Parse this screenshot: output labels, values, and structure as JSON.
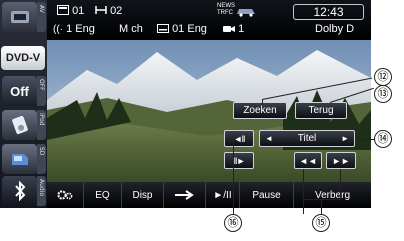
{
  "sidebar": {
    "items": [
      {
        "label": "",
        "strip": "AV"
      },
      {
        "label": "DVD-V",
        "strip": ""
      },
      {
        "label": "Off",
        "strip": "OFF"
      },
      {
        "label": "",
        "strip": "iPod"
      },
      {
        "label": "",
        "strip": "SD"
      },
      {
        "label": "",
        "strip": "Audio"
      }
    ]
  },
  "info": {
    "title_no": "01",
    "chapter_no": "02",
    "audio": "1 Eng",
    "audio_channels": "M ch",
    "subtitle": "01 Eng",
    "news_line1": "NEWS",
    "news_line2": "TRFC",
    "angle": "1",
    "time": "12:43",
    "sound_format": "Dolby D"
  },
  "overlay": {
    "search": "Zoeken",
    "return": "Terug",
    "title_label": "Titel"
  },
  "toolbar": {
    "eq": "EQ",
    "disp": "Disp",
    "play_pause": "►/II",
    "pause": "Pause",
    "hide": "Verberg"
  },
  "callouts": {
    "c12": "⑫",
    "c13": "⑬",
    "c14": "⑭",
    "c15": "⑮",
    "c16": "⑯"
  }
}
